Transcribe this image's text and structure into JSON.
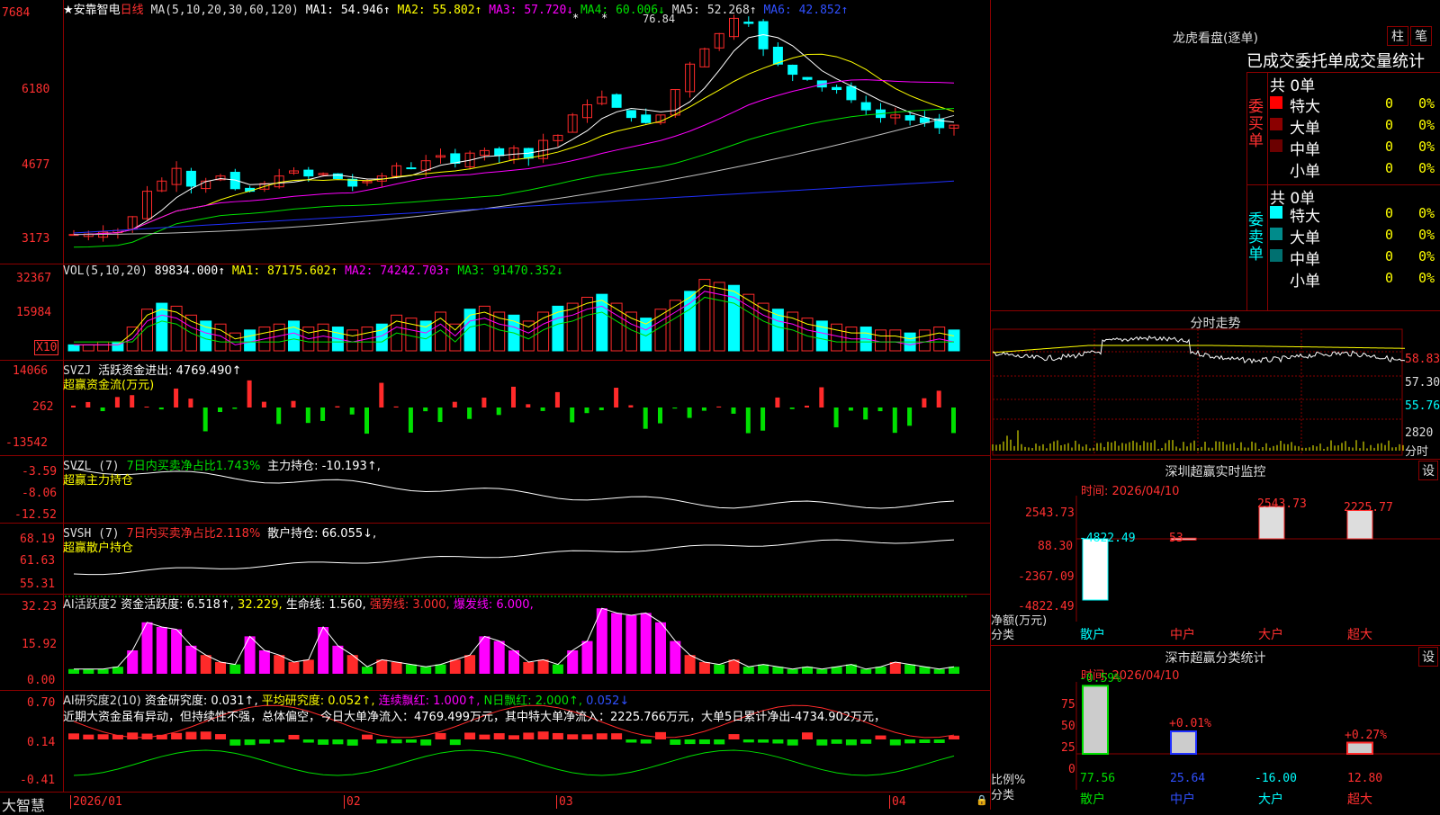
{
  "colors": {
    "up": "#ff2a2a",
    "down": "#00ffff",
    "green": "#00e000",
    "yellow": "#ffff00",
    "magenta": "#ff00ff",
    "white": "#ffffff",
    "gray": "#c0c0c0",
    "blue": "#2030ff",
    "frame": "#8b0000",
    "label_red": "#ff3030"
  },
  "stock": {
    "name": "★安靠智电",
    "period": "日线",
    "ma_label": "MA(5,10,20,30,60,120)",
    "ma1": "MA1: 54.946↑",
    "ma2": "MA2: 55.802↑",
    "ma3": "MA3: 57.720↓",
    "ma4": "MA4: 60.006↓",
    "ma5": "MA5: 52.268↑",
    "ma6": "MA6: 42.852↑",
    "high_marker": "76.84",
    "price_ticks": [
      "7684",
      "6180",
      "4677",
      "3173"
    ]
  },
  "vol": {
    "label": "VOL(5,10,20)",
    "value": "89834.000↑",
    "ma1": "MA1: 87175.602↑",
    "ma2": "MA2: 74242.703↑",
    "ma3": "MA3: 91470.352↓",
    "ticks": [
      "32367",
      "15984"
    ],
    "unit": "X10"
  },
  "svzj": {
    "label": "SVZJ",
    "desc": "活跃资金进出: 4769.490↑",
    "sub": "超赢资金流(万元)",
    "ticks": [
      "14066",
      "262",
      "-13542"
    ]
  },
  "svzl": {
    "label": "SVZL (7)",
    "desc1": "7日内买卖净占比1.743%",
    "desc2": "主力持仓: -10.193↑,",
    "sub": "超赢主力持仓",
    "ticks": [
      "-3.59",
      "-8.06",
      "-12.52"
    ]
  },
  "svsh": {
    "label": "SVSH (7)",
    "desc1": "7日内买卖净占比2.118%",
    "desc2": "散户持仓: 66.055↓,",
    "sub": "超赢散户持仓",
    "ticks": [
      "68.19",
      "61.63",
      "55.31"
    ]
  },
  "ai1": {
    "label": "AI活跃度2",
    "d1": "资金活跃度: 6.518↑,",
    "d2": "32.229,",
    "d3": "生命线: 1.560,",
    "d4": "强势线: 3.000,",
    "d5": "爆发线: 6.000,",
    "ticks": [
      "32.23",
      "15.92",
      "0.00"
    ]
  },
  "ai2": {
    "label": "AI研究度2(10)",
    "d1": "资金研究度: 0.031↑,",
    "d2": "平均研究度: 0.052↑,",
    "d3": "连续飘红: 1.000↑,",
    "d4": "N日飘红: 2.000↑,",
    "d5": "0.052↓",
    "comment": "近期大资金虽有异动，但持续性不强，总体偏空，今日大单净流入：4769.499万元，其中特大单净流入：2225.766万元，大单5日累计净出-4734.902万元，",
    "ticks": [
      "0.70",
      "0.14",
      "-0.41"
    ]
  },
  "xaxis": {
    "logo": "大智慧",
    "labels": [
      "2026/01",
      "02",
      "03",
      "04"
    ]
  },
  "right": {
    "lhb_title": "龙虎看盘(逐单)",
    "btn_bar": "柱",
    "btn_pen": "笔",
    "stats_title": "已成交委托单成交量统计",
    "buy": {
      "side": "委买单",
      "total": "共 0单",
      "rows": [
        {
          "name": "特大",
          "val": "0",
          "pct": "0%"
        },
        {
          "name": "大单",
          "val": "0",
          "pct": "0%"
        },
        {
          "name": "中单",
          "val": "0",
          "pct": "0%"
        },
        {
          "name": "小单",
          "val": "0",
          "pct": "0%"
        }
      ]
    },
    "sell": {
      "side": "委卖单",
      "total": "共 0单",
      "rows": [
        {
          "name": "特大",
          "val": "0",
          "pct": "0%"
        },
        {
          "name": "大单",
          "val": "0",
          "pct": "0%"
        },
        {
          "name": "中单",
          "val": "0",
          "pct": "0%"
        },
        {
          "name": "小单",
          "val": "0",
          "pct": "0%"
        }
      ]
    },
    "fenshi": {
      "title": "分时走势",
      "ticks": [
        "58.83",
        "57.30",
        "55.76"
      ],
      "vol_tick": "2820",
      "vol_unit": "分时"
    },
    "sz": {
      "title": "深圳超赢实时监控",
      "btn": "设",
      "time": "时间: 2026/04/10",
      "ylabel": "净额(万元)",
      "xlabel": "分类",
      "ticks": [
        "2543.73",
        "88.30",
        "-2367.09",
        "-4822.49"
      ],
      "cats": [
        "散户",
        "中户",
        "大户",
        "超大"
      ],
      "vals": [
        "-4822.49",
        "53",
        "2543.73",
        "2225.77"
      ]
    },
    "cls": {
      "title": "深市超赢分类统计",
      "btn": "设",
      "time": "时间: 2026/04/10",
      "ylabel": "比例%",
      "xlabel": "分类",
      "ticks": [
        "75",
        "50",
        "25",
        "0"
      ],
      "cats": [
        "散户",
        "中户",
        "大户",
        "超大"
      ],
      "bottom": [
        "77.56",
        "25.64",
        "-16.00",
        "12.80"
      ],
      "top": [
        "-0.59%",
        "+0.01%",
        "",
        "+0.27%"
      ]
    }
  },
  "chart_data": [
    {
      "type": "candlestick",
      "title": "安靠智电 日线",
      "ylim": [
        3173,
        7684
      ],
      "ylabel": "",
      "x": [
        "2026/01",
        "02",
        "03",
        "04"
      ],
      "series_names": [
        "MA1",
        "MA2",
        "MA3",
        "MA4",
        "MA5",
        "MA6"
      ],
      "annotation": "76.84"
    },
    {
      "type": "bar",
      "title": "VOL(5,10,20)",
      "ylim": [
        0,
        32367
      ]
    },
    {
      "type": "bar",
      "title": "SVZJ 活跃资金进出",
      "ylim": [
        -13542,
        14066
      ]
    },
    {
      "type": "line",
      "title": "SVZL 主力持仓",
      "ylim": [
        -12.52,
        -3.59
      ]
    },
    {
      "type": "line",
      "title": "SVSH 散户持仓",
      "ylim": [
        55.31,
        68.19
      ]
    },
    {
      "type": "bar",
      "title": "AI活跃度2",
      "ylim": [
        0,
        32.23
      ]
    },
    {
      "type": "bar",
      "title": "AI研究度2(10)",
      "ylim": [
        -0.41,
        0.7
      ]
    }
  ]
}
